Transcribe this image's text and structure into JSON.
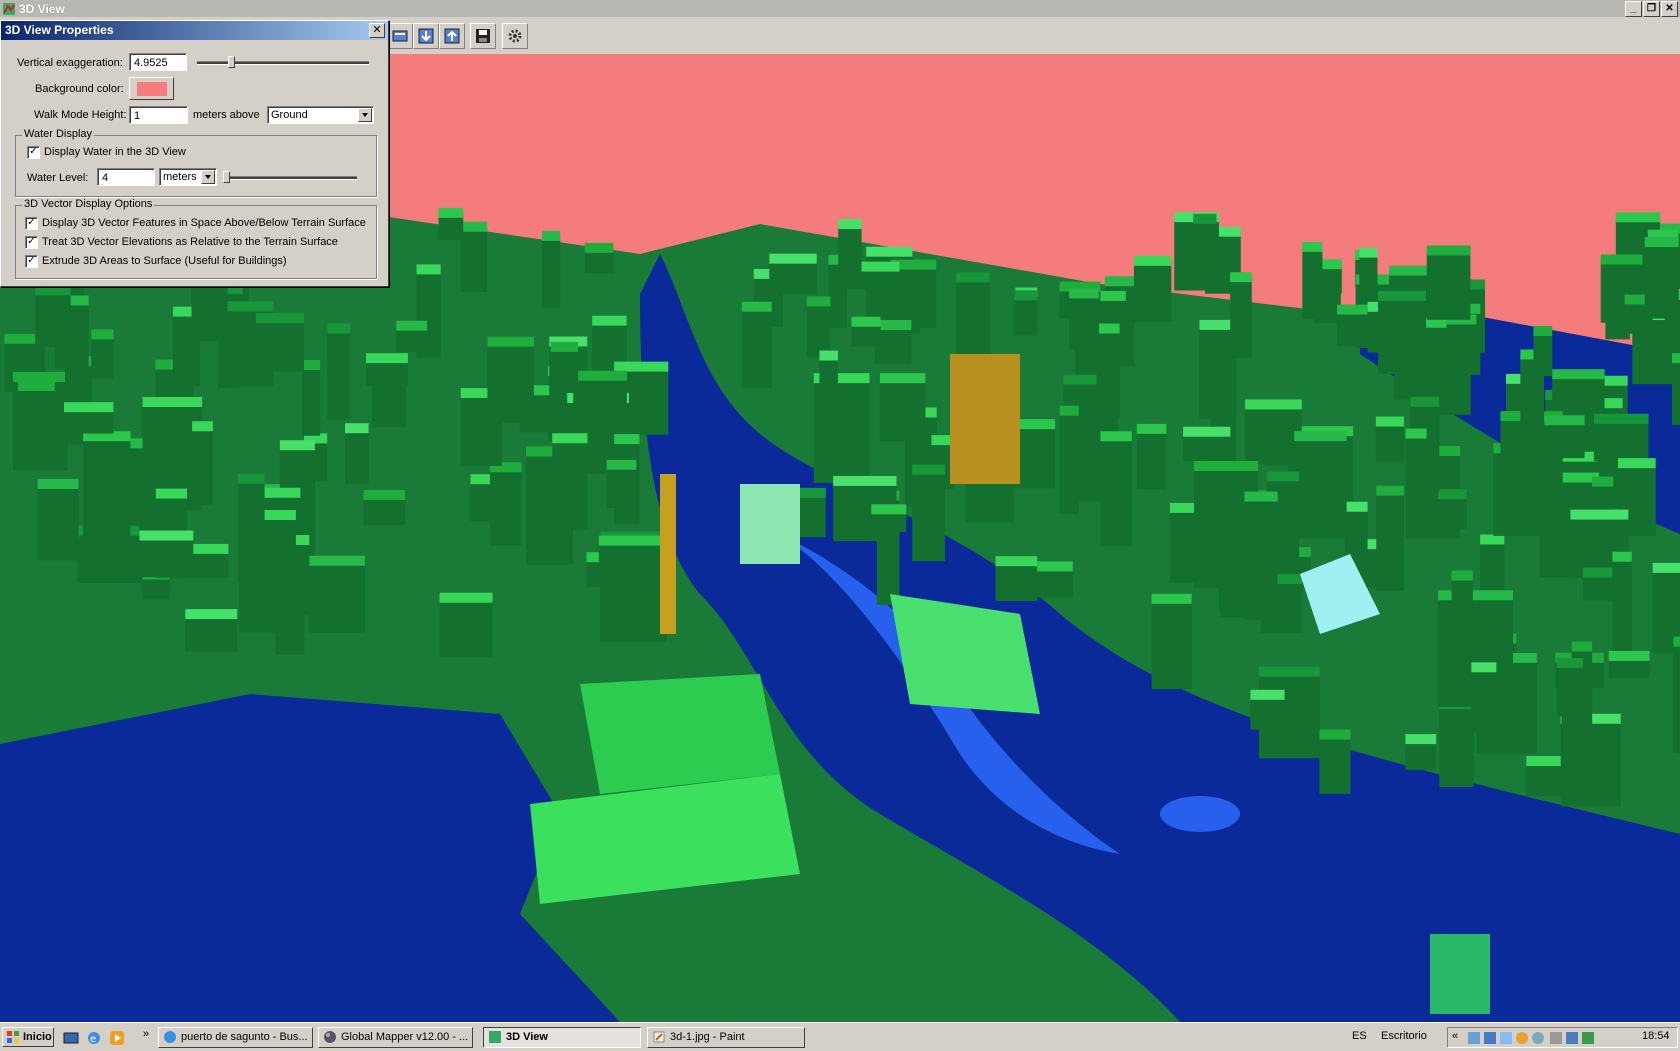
{
  "window": {
    "title": "3D View",
    "controls": [
      "minimize",
      "restore",
      "close"
    ]
  },
  "toolbar": {
    "buttons": [
      "view-layers",
      "download",
      "upload",
      "save",
      "settings"
    ]
  },
  "scene": {
    "background_color": "#f47c7c",
    "terrain_color": "#1a7a38",
    "building_color": "#2ccc50",
    "water_color": "#0a2a9a",
    "shallow_water_color": "#2860ee"
  },
  "dialog": {
    "title": "3D View Properties",
    "close": "✕",
    "vertical_exaggeration": {
      "label": "Vertical exaggeration:",
      "value": "4.9525",
      "level": 0.2
    },
    "background_color": {
      "label": "Background color:",
      "color": "#f47c7c"
    },
    "walk_mode": {
      "label": "Walk Mode Height:",
      "value": "1",
      "suffix": "meters above",
      "option": "Ground"
    },
    "water_group": {
      "title": "Water Display",
      "display_water": {
        "label": "Display Water in the 3D View",
        "checked": true
      },
      "water_level": {
        "label": "Water Level:",
        "value": "4",
        "unit": "meters",
        "level": 0.02
      }
    },
    "vector_group": {
      "title": "3D Vector Display Options",
      "options": [
        {
          "label": "Display 3D Vector Features in Space Above/Below Terrain Surface",
          "checked": true
        },
        {
          "label": "Treat 3D Vector Elevations as Relative to the Terrain Surface",
          "checked": true
        },
        {
          "label": "Extrude 3D Areas to Surface (Useful for Buildings)",
          "checked": true
        }
      ]
    }
  },
  "taskbar": {
    "start": "Inicio",
    "tasks": [
      {
        "label": "puerto de sagunto - Bus...",
        "active": false
      },
      {
        "label": "Global Mapper v12.00 - ...",
        "active": false
      },
      {
        "label": "3D View",
        "active": true
      },
      {
        "label": "3d-1.jpg - Paint",
        "active": false
      }
    ],
    "language": "ES",
    "desktop": "Escritorio",
    "chevron": "«",
    "clock": "18:54"
  }
}
